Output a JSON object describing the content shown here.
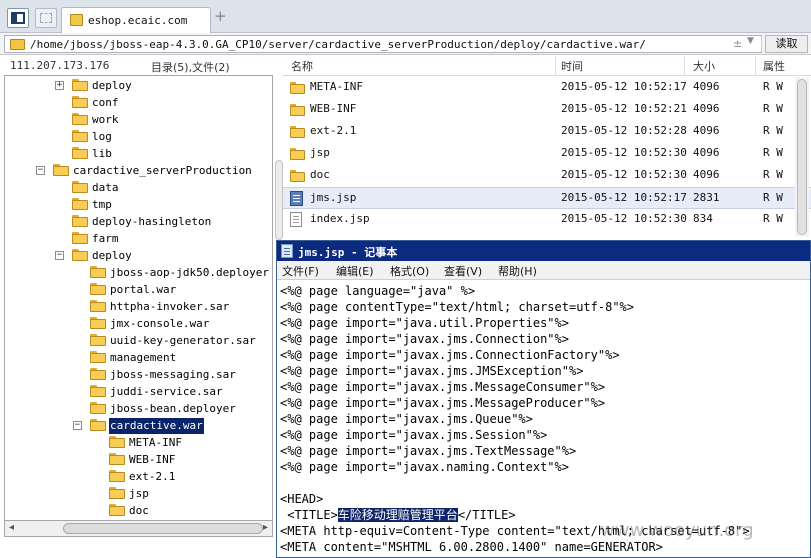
{
  "tabbar": {
    "active_tab_title": "eshop.ecaic.com",
    "new_tab_glyph": "+"
  },
  "address": {
    "path": "/home/jboss/jboss-eap-4.3.0.GA_CP10/server/cardactive_serverProduction/deploy/cardactive.war/",
    "up_glyph": "±",
    "down_glyph": "▼",
    "read_label": "读取"
  },
  "left_panel": {
    "ip": "111.207.173.176",
    "dir_count": "目录(5),文件(2)",
    "tree": [
      {
        "label": "deploy",
        "expander": "+"
      },
      {
        "label": "conf"
      },
      {
        "label": "work"
      },
      {
        "label": "log"
      },
      {
        "label": "lib"
      },
      {
        "label": "cardactive_serverProduction",
        "expander": "−"
      },
      {
        "label": "data"
      },
      {
        "label": "tmp"
      },
      {
        "label": "deploy-hasingleton"
      },
      {
        "label": "farm"
      },
      {
        "label": "deploy",
        "expander": "−"
      },
      {
        "label": "jboss-aop-jdk50.deployer"
      },
      {
        "label": "portal.war"
      },
      {
        "label": "httpha-invoker.sar"
      },
      {
        "label": "jmx-console.war"
      },
      {
        "label": "uuid-key-generator.sar"
      },
      {
        "label": "management"
      },
      {
        "label": "jboss-messaging.sar"
      },
      {
        "label": "juddi-service.sar"
      },
      {
        "label": "jboss-bean.deployer"
      },
      {
        "label": "cardactive.war",
        "expander": "−",
        "selected": true
      },
      {
        "label": "META-INF"
      },
      {
        "label": "WEB-INF"
      },
      {
        "label": "ext-2.1"
      },
      {
        "label": "jsp"
      },
      {
        "label": "doc"
      }
    ]
  },
  "file_list": {
    "headers": {
      "name": "名称",
      "time": "时间",
      "size": "大小",
      "attr": "属性"
    },
    "rows": [
      {
        "name": "META-INF",
        "time": "2015-05-12 10:52:17",
        "size": "4096",
        "attr": "R W",
        "icon": "folder-icon"
      },
      {
        "name": "WEB-INF",
        "time": "2015-05-12 10:52:21",
        "size": "4096",
        "attr": "R W",
        "icon": "folder-icon"
      },
      {
        "name": "ext-2.1",
        "time": "2015-05-12 10:52:28",
        "size": "4096",
        "attr": "R W",
        "icon": "folder-icon"
      },
      {
        "name": "jsp",
        "time": "2015-05-12 10:52:30",
        "size": "4096",
        "attr": "R W",
        "icon": "folder-icon"
      },
      {
        "name": "doc",
        "time": "2015-05-12 10:52:30",
        "size": "4096",
        "attr": "R W",
        "icon": "folder-icon"
      },
      {
        "name": "jms.jsp",
        "time": "2015-05-12 10:52:17",
        "size": "2831",
        "attr": "R W",
        "icon": "jsp-file-icon",
        "selected": true
      },
      {
        "name": "index.jsp",
        "time": "2015-05-12 10:52:30",
        "size": "834",
        "attr": "R W",
        "icon": "document-icon"
      }
    ]
  },
  "notepad": {
    "title": "jms.jsp - 记事本",
    "menu": [
      "文件(F)",
      "编辑(E)",
      "格式(O)",
      "查看(V)",
      "帮助(H)"
    ],
    "lines": [
      "<%@ page language=\"java\" %>",
      "<%@ page contentType=\"text/html; charset=utf-8\"%>",
      "<%@ page import=\"java.util.Properties\"%>",
      "<%@ page import=\"javax.jms.Connection\"%>",
      "<%@ page import=\"javax.jms.ConnectionFactory\"%>",
      "<%@ page import=\"javax.jms.JMSException\"%>",
      "<%@ page import=\"javax.jms.MessageConsumer\"%>",
      "<%@ page import=\"javax.jms.MessageProducer\"%>",
      "<%@ page import=\"javax.jms.Queue\"%>",
      "<%@ page import=\"javax.jms.Session\"%>",
      "<%@ page import=\"javax.jms.TextMessage\"%>",
      "<%@ page import=\"javax.naming.Context\"%>",
      "",
      "<HEAD>",
      " <TITLE>",
      "<META http-equiv=Content-Type content=\"text/html; charset=utf-8\">",
      "<META content=\"MSHTML 6.00.2800.1400\" name=GENERATOR>"
    ],
    "title_tag_open": " <TITLE>",
    "title_highlight": "车险移动理赔管理平台",
    "title_tag_close": "</TITLE>"
  },
  "watermark": "www.wooyun.org"
}
